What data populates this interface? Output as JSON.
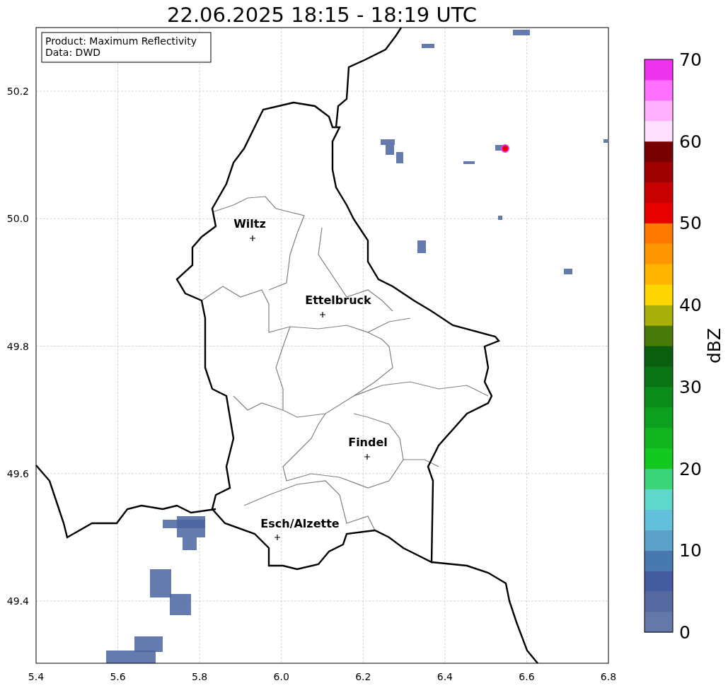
{
  "title": "22.06.2025 18:15 - 18:19 UTC",
  "info_box": [
    "Product: Maximum Reflectivity",
    "Data: DWD"
  ],
  "x_ticks": [
    "5.4",
    "5.6",
    "5.8",
    "6.0",
    "6.2",
    "6.4",
    "6.6",
    "6.8"
  ],
  "y_ticks": [
    "50.2",
    "50.0",
    "49.8",
    "49.6",
    "49.4"
  ],
  "places": [
    {
      "name": "Wiltz"
    },
    {
      "name": "Ettelbruck"
    },
    {
      "name": "Findel"
    },
    {
      "name": "Esch/Alzette"
    }
  ],
  "colorbar": {
    "label": "dBZ",
    "ticks": [
      "70",
      "60",
      "50",
      "40",
      "30",
      "20",
      "10",
      "0"
    ],
    "bands": [
      {
        "color": "#6677aa"
      },
      {
        "color": "#5568a0"
      },
      {
        "color": "#445c9f"
      },
      {
        "color": "#4878b0"
      },
      {
        "color": "#5aa0c8"
      },
      {
        "color": "#62c0dc"
      },
      {
        "color": "#5ed8c8"
      },
      {
        "color": "#3cd479"
      },
      {
        "color": "#13c81e"
      },
      {
        "color": "#0fb41e"
      },
      {
        "color": "#0ca01e"
      },
      {
        "color": "#0a8c1a"
      },
      {
        "color": "#0a7414"
      },
      {
        "color": "#0b5e0e"
      },
      {
        "color": "#4a7a0a"
      },
      {
        "color": "#aab00a"
      },
      {
        "color": "#ffd700"
      },
      {
        "color": "#ffb400"
      },
      {
        "color": "#ff9600"
      },
      {
        "color": "#ff7800"
      },
      {
        "color": "#e60000"
      },
      {
        "color": "#c80000"
      },
      {
        "color": "#a00000"
      },
      {
        "color": "#780000"
      },
      {
        "color": "#ffe0ff"
      },
      {
        "color": "#ffb0ff"
      },
      {
        "color": "#ff70ff"
      },
      {
        "color": "#ee33ee"
      }
    ]
  }
}
